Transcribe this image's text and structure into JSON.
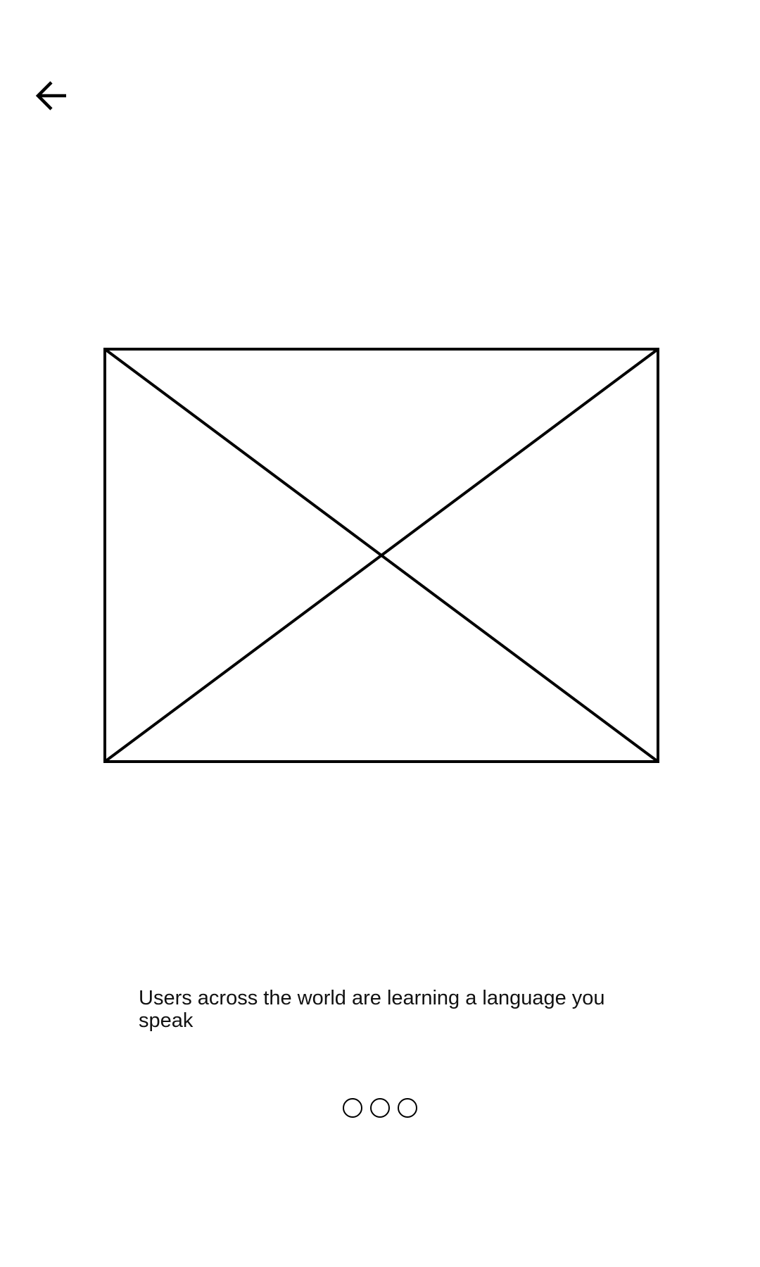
{
  "header": {
    "back_icon": "arrow-left-icon"
  },
  "hero": {
    "icon": "image-placeholder-icon"
  },
  "onboarding": {
    "caption": "Users across the world are learning a language you speak"
  },
  "pager": {
    "total_pages": 3
  }
}
